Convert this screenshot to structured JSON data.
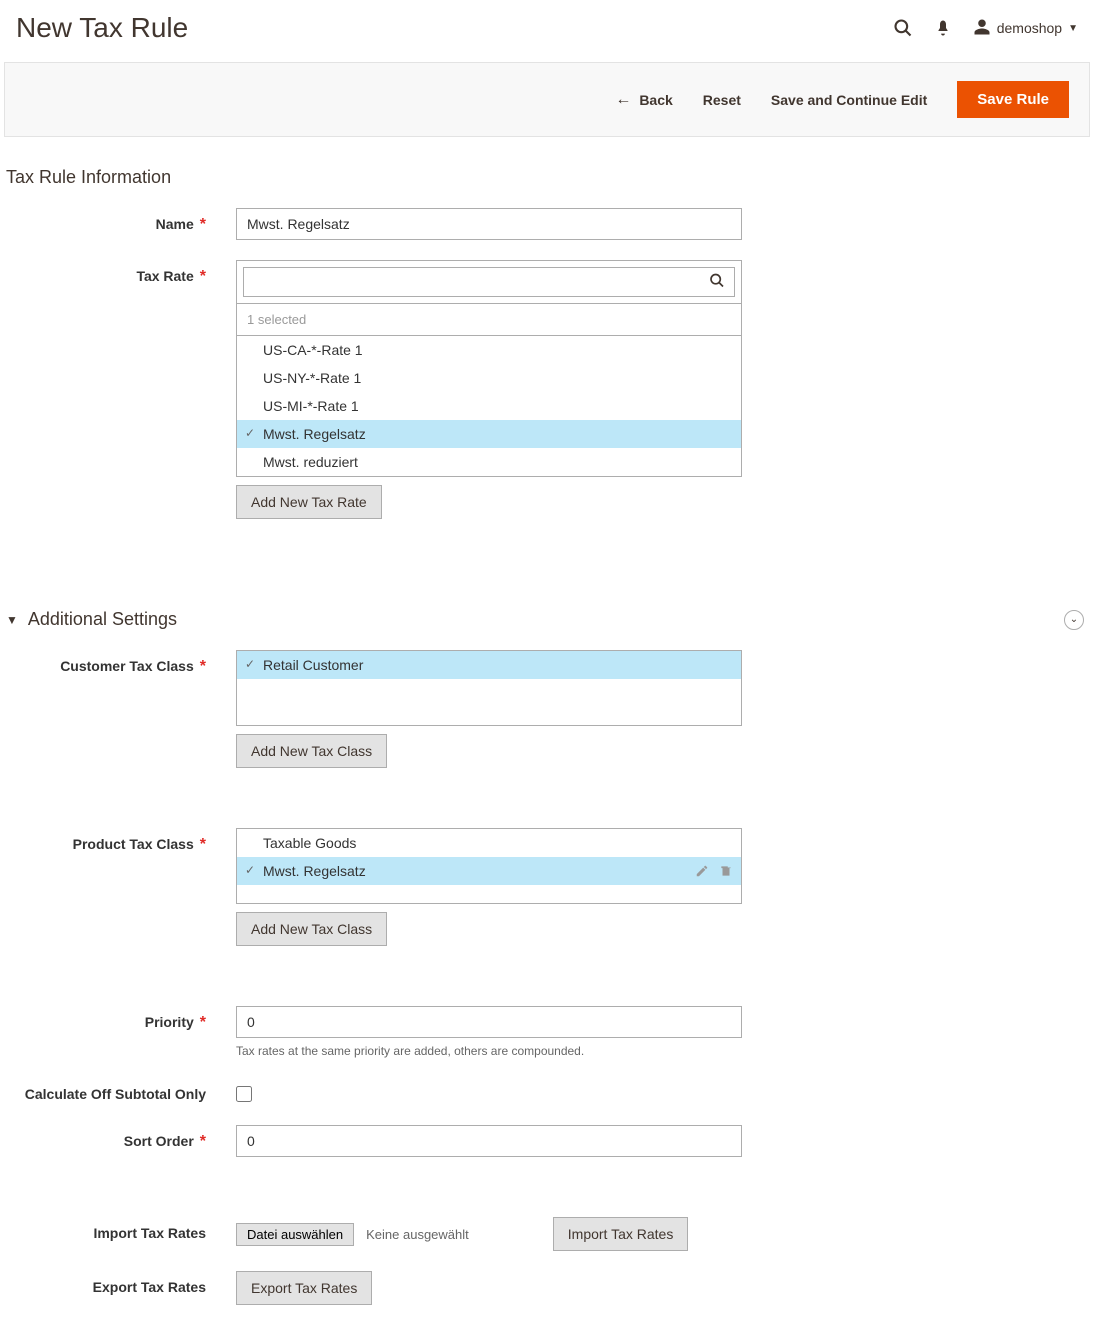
{
  "header": {
    "title": "New Tax Rule",
    "user_name": "demoshop"
  },
  "action_bar": {
    "back": "Back",
    "reset": "Reset",
    "save_continue": "Save and Continue Edit",
    "save": "Save Rule"
  },
  "tax_rule_info": {
    "heading": "Tax Rule Information",
    "name_label": "Name",
    "name_value": "Mwst. Regelsatz",
    "tax_rate_label": "Tax Rate",
    "selected_count": "1 selected",
    "rates": {
      "0": {
        "label": "US-CA-*-Rate 1"
      },
      "1": {
        "label": "US-NY-*-Rate 1"
      },
      "2": {
        "label": "US-MI-*-Rate 1"
      },
      "3": {
        "label": "Mwst. Regelsatz"
      },
      "4": {
        "label": "Mwst. reduziert"
      }
    },
    "add_rate_btn": "Add New Tax Rate"
  },
  "additional": {
    "heading": "Additional Settings",
    "customer_class_label": "Customer Tax Class",
    "customer_classes": {
      "0": {
        "label": "Retail Customer"
      }
    },
    "add_customer_class_btn": "Add New Tax Class",
    "product_class_label": "Product Tax Class",
    "product_classes": {
      "0": {
        "label": "Taxable Goods"
      },
      "1": {
        "label": "Mwst. Regelsatz"
      }
    },
    "add_product_class_btn": "Add New Tax Class",
    "priority_label": "Priority",
    "priority_value": "0",
    "priority_help": "Tax rates at the same priority are added, others are compounded.",
    "subtotal_label": "Calculate Off Subtotal Only",
    "sort_order_label": "Sort Order",
    "sort_order_value": "0",
    "import_label": "Import Tax Rates",
    "file_btn": "Datei auswählen",
    "file_text": "Keine ausgewählt",
    "import_btn": "Import Tax Rates",
    "export_label": "Export Tax Rates",
    "export_btn": "Export Tax Rates"
  }
}
